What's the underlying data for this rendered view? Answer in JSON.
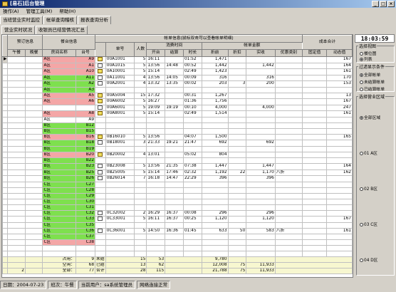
{
  "window": {
    "title": "[易石]后台管理"
  },
  "menu": [
    "操作(A)",
    "管理工具(M)",
    "帮助(H)"
  ],
  "tabs": [
    "当班营业实时监控",
    "帐单查询稽核",
    "报表查询分析"
  ],
  "subtabs": [
    "营业实时状况",
    "收银员已结营情况汇总"
  ],
  "table": {
    "group1": "预订信息",
    "group2": "餐台信息",
    "group3": "帐单信息(鼠标双击可以查看帐单明细)",
    "sub_time": "消费时间",
    "sub_amount": "帐单金额",
    "sub_cost": "成本合计",
    "headers": [
      "午餐",
      "晚餐",
      "房间名称",
      "台号",
      "",
      "单号",
      "人数",
      "开台",
      "结算",
      "时长",
      "折前",
      "折扣",
      "实收",
      "优惠类别",
      "固定值",
      "动态值"
    ],
    "rows": [
      {
        "c": "pink",
        "area": "A区",
        "no": "A9",
        "bill": "00A1001",
        "p": "5",
        "open": "16:11",
        "close": "",
        "dur": "01:52",
        "pre": "1,471",
        "disc": "",
        "paid": "",
        "cat": "",
        "fix": "",
        "dyn": "167",
        "icon": "cash",
        "sel": true
      },
      {
        "c": "pink",
        "area": "A区",
        "no": "A1",
        "bill": "00A1015",
        "p": "5",
        "open": "13:56",
        "close": "14:48",
        "dur": "00:52",
        "pre": "1,442",
        "disc": "",
        "paid": "1,442",
        "cat": "",
        "fix": "",
        "dyn": "164",
        "icon": "doc"
      },
      {
        "c": "pink",
        "area": "A区",
        "no": "A10",
        "bill": "0A10001",
        "p": "5",
        "open": "15:14",
        "close": "",
        "dur": "02:49",
        "pre": "1,423",
        "disc": "",
        "paid": "",
        "cat": "",
        "fix": "",
        "dyn": "161",
        "icon": "cash"
      },
      {
        "c": "green",
        "area": "A区",
        "no": "A11",
        "bill": "0A11001",
        "p": "4",
        "open": "13:56",
        "close": "14:05",
        "dur": "00:09",
        "pre": "316",
        "disc": "",
        "paid": "316",
        "cat": "",
        "fix": "",
        "dyn": "170",
        "icon": "doc"
      },
      {
        "c": "green",
        "area": "A区",
        "no": "A2",
        "bill": "00A2001",
        "p": "4",
        "open": "13:32",
        "close": "13:35",
        "dur": "00:02",
        "pre": "203",
        "disc": "3",
        "paid": "200",
        "cat": "",
        "fix": "",
        "dyn": "153",
        "icon": "doc"
      },
      {
        "c": "green",
        "area": "A区",
        "no": "A3",
        "bill": "",
        "p": "",
        "open": "",
        "close": "",
        "dur": "",
        "pre": "",
        "disc": "",
        "paid": "",
        "cat": "",
        "fix": "",
        "dyn": "",
        "icon": ""
      },
      {
        "c": "pink",
        "area": "A区",
        "no": "A5",
        "bill": "00A5004",
        "p": "15",
        "open": "17:32",
        "close": "",
        "dur": "00:31",
        "pre": "1,267",
        "disc": "",
        "paid": "",
        "cat": "",
        "fix": "",
        "dyn": "13",
        "icon": "cash"
      },
      {
        "c": "pink",
        "area": "A区",
        "no": "A6",
        "bill": "00A6002",
        "p": "5",
        "open": "16:27",
        "close": "",
        "dur": "01:36",
        "pre": "1,756",
        "disc": "",
        "paid": "",
        "cat": "",
        "fix": "",
        "dyn": "167",
        "icon": "cash"
      },
      {
        "c": "",
        "area": "",
        "no": "",
        "bill": "00A6001",
        "p": "5",
        "open": "19:09",
        "close": "19:19",
        "dur": "00:10",
        "pre": "4,000",
        "disc": "",
        "paid": "4,000",
        "cat": "",
        "fix": "",
        "dyn": "247",
        "icon": "doc"
      },
      {
        "c": "pink",
        "area": "A区",
        "no": "A8",
        "bill": "00A8001",
        "p": "5",
        "open": "15:14",
        "close": "",
        "dur": "02:49",
        "pre": "1,514",
        "disc": "",
        "paid": "",
        "cat": "",
        "fix": "",
        "dyn": "161",
        "icon": "cash"
      },
      {
        "c": "",
        "area": "A区",
        "no": "A9",
        "bill": "",
        "p": "",
        "open": "",
        "close": "",
        "dur": "",
        "pre": "",
        "disc": "",
        "paid": "",
        "cat": "",
        "fix": "",
        "dyn": "",
        "icon": ""
      },
      {
        "c": "green",
        "area": "B区",
        "no": "B12",
        "bill": "",
        "p": "",
        "open": "",
        "close": "",
        "dur": "",
        "pre": "",
        "disc": "",
        "paid": "",
        "cat": "",
        "fix": "",
        "dyn": "",
        "icon": ""
      },
      {
        "c": "green",
        "area": "B区",
        "no": "B15",
        "bill": "",
        "p": "",
        "open": "",
        "close": "",
        "dur": "",
        "pre": "",
        "disc": "",
        "paid": "",
        "cat": "",
        "fix": "",
        "dyn": "",
        "icon": ""
      },
      {
        "c": "pink",
        "area": "B区",
        "no": "B16",
        "bill": "0B16010",
        "p": "5",
        "open": "13:56",
        "close": "",
        "dur": "04:07",
        "pre": "1,500",
        "disc": "",
        "paid": "",
        "cat": "",
        "fix": "",
        "dyn": "165",
        "icon": "cash"
      },
      {
        "c": "green",
        "area": "B区",
        "no": "B18",
        "bill": "0B18001",
        "p": "3",
        "open": "21:33",
        "close": "19:21",
        "dur": "21:47",
        "pre": "692",
        "disc": "",
        "paid": "692",
        "cat": "",
        "fix": "",
        "dyn": "",
        "icon": "doc"
      },
      {
        "c": "green",
        "area": "B区",
        "no": "B19",
        "bill": "",
        "p": "",
        "open": "",
        "close": "",
        "dur": "",
        "pre": "",
        "disc": "",
        "paid": "",
        "cat": "",
        "fix": "",
        "dyn": "",
        "icon": ""
      },
      {
        "c": "pink",
        "area": "B区",
        "no": "B20",
        "bill": "0B20002",
        "p": "4",
        "open": "13:01",
        "close": "",
        "dur": "05:02",
        "pre": "804",
        "disc": "",
        "paid": "",
        "cat": "",
        "fix": "",
        "dyn": "",
        "icon": "cash"
      },
      {
        "c": "green",
        "area": "B区",
        "no": "B22",
        "bill": "",
        "p": "",
        "open": "",
        "close": "",
        "dur": "",
        "pre": "",
        "disc": "",
        "paid": "",
        "cat": "",
        "fix": "",
        "dyn": "",
        "icon": ""
      },
      {
        "c": "green",
        "area": "B区",
        "no": "B23",
        "bill": "0B23008",
        "p": "5",
        "open": "13:56",
        "close": "21:35",
        "dur": "07:38",
        "pre": "1,447",
        "disc": "",
        "paid": "1,447",
        "cat": "",
        "fix": "",
        "dyn": "164",
        "icon": "doc"
      },
      {
        "c": "green",
        "area": "B区",
        "no": "B25",
        "bill": "0B25005",
        "p": "5",
        "open": "15:14",
        "close": "17:46",
        "dur": "02:32",
        "pre": "1,192",
        "disc": "22",
        "paid": "1,170",
        "cat": "八折",
        "fix": "",
        "dyn": "162",
        "icon": "doc"
      },
      {
        "c": "green",
        "area": "B区",
        "no": "B26",
        "bill": "0B26014",
        "p": "7",
        "open": "16:18",
        "close": "14:47",
        "dur": "22:29",
        "pre": "396",
        "disc": "",
        "paid": "396",
        "cat": "",
        "fix": "",
        "dyn": "",
        "icon": "doc"
      },
      {
        "c": "green",
        "area": "C区",
        "no": "C27",
        "bill": "",
        "p": "",
        "open": "",
        "close": "",
        "dur": "",
        "pre": "",
        "disc": "",
        "paid": "",
        "cat": "",
        "fix": "",
        "dyn": "",
        "icon": ""
      },
      {
        "c": "green",
        "area": "C区",
        "no": "C28",
        "bill": "",
        "p": "",
        "open": "",
        "close": "",
        "dur": "",
        "pre": "",
        "disc": "",
        "paid": "",
        "cat": "",
        "fix": "",
        "dyn": "",
        "icon": ""
      },
      {
        "c": "green",
        "area": "C区",
        "no": "C29",
        "bill": "",
        "p": "",
        "open": "",
        "close": "",
        "dur": "",
        "pre": "",
        "disc": "",
        "paid": "",
        "cat": "",
        "fix": "",
        "dyn": "",
        "icon": ""
      },
      {
        "c": "green",
        "area": "C区",
        "no": "C30",
        "bill": "",
        "p": "",
        "open": "",
        "close": "",
        "dur": "",
        "pre": "",
        "disc": "",
        "paid": "",
        "cat": "",
        "fix": "",
        "dyn": "",
        "icon": ""
      },
      {
        "c": "green",
        "area": "C区",
        "no": "C31",
        "bill": "",
        "p": "",
        "open": "",
        "close": "",
        "dur": "",
        "pre": "",
        "disc": "",
        "paid": "",
        "cat": "",
        "fix": "",
        "dyn": "",
        "icon": ""
      },
      {
        "c": "green",
        "area": "C区",
        "no": "C32",
        "bill": "0C32002",
        "p": "2",
        "open": "16:29",
        "close": "16:37",
        "dur": "00:08",
        "pre": "296",
        "disc": "",
        "paid": "296",
        "cat": "",
        "fix": "",
        "dyn": "",
        "icon": "doc"
      },
      {
        "c": "green",
        "area": "C区",
        "no": "C33",
        "bill": "0C33001",
        "p": "5",
        "open": "16:11",
        "close": "16:37",
        "dur": "00:25",
        "pre": "1,120",
        "disc": "",
        "paid": "1,120",
        "cat": "",
        "fix": "",
        "dyn": "167",
        "icon": "doc"
      },
      {
        "c": "green",
        "area": "C区",
        "no": "C35",
        "bill": "",
        "p": "",
        "open": "",
        "close": "",
        "dur": "",
        "pre": "",
        "disc": "",
        "paid": "",
        "cat": "",
        "fix": "",
        "dyn": "",
        "icon": ""
      },
      {
        "c": "green",
        "area": "C区",
        "no": "C36",
        "bill": "0C36001",
        "p": "5",
        "open": "14:50",
        "close": "16:36",
        "dur": "01:45",
        "pre": "633",
        "disc": "50",
        "paid": "583",
        "cat": "八折",
        "fix": "",
        "dyn": "161",
        "icon": "doc"
      },
      {
        "c": "green",
        "area": "C区",
        "no": "C37",
        "bill": "",
        "p": "",
        "open": "",
        "close": "",
        "dur": "",
        "pre": "",
        "disc": "",
        "paid": "",
        "cat": "",
        "fix": "",
        "dyn": "",
        "icon": ""
      },
      {
        "c": "pink",
        "area": "C区",
        "no": "C38",
        "bill": "",
        "p": "",
        "open": "",
        "close": "",
        "dur": "",
        "pre": "",
        "disc": "",
        "paid": "",
        "cat": "",
        "fix": "",
        "dyn": "",
        "icon": ""
      }
    ],
    "summary": [
      {
        "a": "",
        "b": "",
        "label": "占用：",
        "val": "9",
        "k": "未结",
        "p": "15",
        "n": "53",
        "pre": "9,780",
        "disc": "",
        "paid": "",
        "dyn": "",
        "cls": "pink"
      },
      {
        "a": "",
        "b": "",
        "label": "空闲：",
        "val": "68",
        "k": "已结",
        "p": "13",
        "n": "62",
        "pre": "12,008",
        "disc": "75",
        "paid": "11,933",
        "dyn": "",
        "cls": "green"
      },
      {
        "a": "2",
        "b": "",
        "label": "全部：",
        "val": "77",
        "k": "合计",
        "p": "28",
        "n": "115",
        "pre": "21,788",
        "disc": "75",
        "paid": "11,933",
        "dyn": "",
        "cls": ""
      }
    ]
  },
  "right": {
    "clock": "18:03:59",
    "view_title": "选择视图",
    "view_opts": [
      "餐位图",
      "列表"
    ],
    "filter_title": "过滤显示条件",
    "filter_opts": [
      "全部帐单",
      "未结算帐单",
      "已结算帐单"
    ],
    "area_title": "选择营业区域",
    "area_opts": [
      "全部区域",
      "01 A区",
      "02 B区",
      "03 C区",
      "04 D区"
    ]
  },
  "status": {
    "date": "日期：2004-07-23",
    "shift": "班次：午餐",
    "user": "当前用户：sa系统管理员",
    "net": "网络连接正常"
  }
}
